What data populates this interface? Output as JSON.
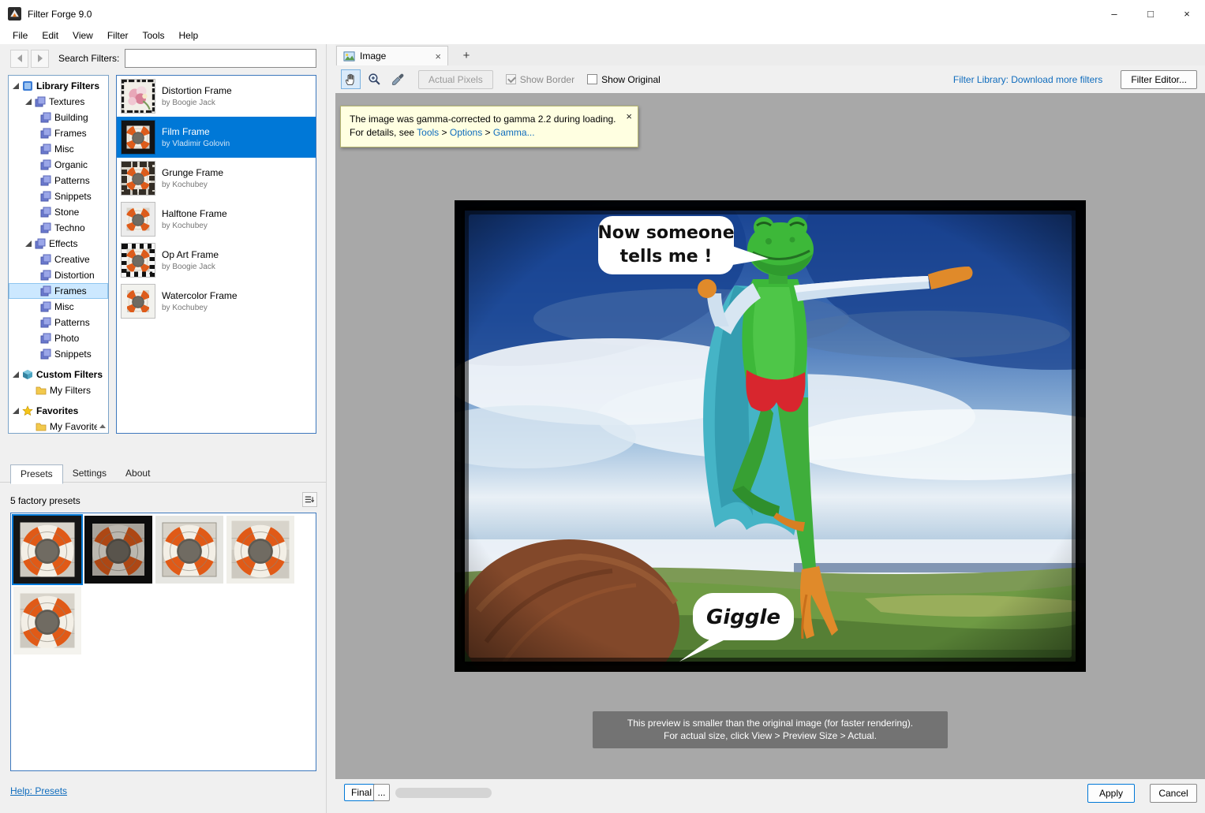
{
  "window": {
    "title": "Filter Forge 9.0",
    "minimize": "–",
    "maximize": "□",
    "close": "×"
  },
  "menu": {
    "items": [
      "File",
      "Edit",
      "View",
      "Filter",
      "Tools",
      "Help"
    ]
  },
  "browser": {
    "search_label": "Search Filters:",
    "tree": [
      {
        "label": "Library Filters"
      },
      {
        "label": "Textures"
      },
      {
        "label": "Building"
      },
      {
        "label": "Frames"
      },
      {
        "label": "Misc"
      },
      {
        "label": "Organic"
      },
      {
        "label": "Patterns"
      },
      {
        "label": "Snippets"
      },
      {
        "label": "Stone"
      },
      {
        "label": "Techno"
      },
      {
        "label": "Effects"
      },
      {
        "label": "Creative"
      },
      {
        "label": "Distortion"
      },
      {
        "label": "Frames"
      },
      {
        "label": "Misc"
      },
      {
        "label": "Patterns"
      },
      {
        "label": "Photo"
      },
      {
        "label": "Snippets"
      },
      {
        "label": "Custom Filters"
      },
      {
        "label": "My Filters"
      },
      {
        "label": "Favorites"
      },
      {
        "label": "My Favorites"
      }
    ],
    "filters": [
      {
        "name": "Distortion Frame",
        "author": "by Boogie Jack"
      },
      {
        "name": "Film Frame",
        "author": "by Vladimir Golovin"
      },
      {
        "name": "Grunge Frame",
        "author": "by Kochubey"
      },
      {
        "name": "Halftone Frame",
        "author": "by Kochubey"
      },
      {
        "name": "Op Art Frame",
        "author": "by Boogie Jack"
      },
      {
        "name": "Watercolor Frame",
        "author": "by Kochubey"
      }
    ]
  },
  "presets": {
    "tabs": [
      "Presets",
      "Settings",
      "About"
    ],
    "count_label": "5 factory presets",
    "help_link": "Help: Presets"
  },
  "workspace": {
    "tab_label": "Image",
    "tab_close": "×",
    "new_tab": "+",
    "toolbar": {
      "actual_pixels": "Actual Pixels",
      "show_border": "Show Border",
      "show_original": "Show Original",
      "library_link": "Filter Library: Download more filters",
      "filter_editor": "Filter Editor..."
    },
    "gamma_note": {
      "line1": "The image was gamma-corrected to gamma 2.2 during loading.",
      "line2_prefix": "For details, see ",
      "link_tools": "Tools",
      "link_options": "Options",
      "link_gamma": "Gamma...",
      "sep": " > ",
      "close": "×"
    },
    "image": {
      "bubble1_line1": "Now someone",
      "bubble1_line2": "tells me !",
      "bubble2": "Giggle"
    },
    "preview_note": {
      "line1": "This preview is smaller than the original image (for faster rendering).",
      "line2": "For actual size, click View > Preview Size > Actual."
    },
    "bottom": {
      "final": "Final",
      "more": "...",
      "apply": "Apply",
      "cancel": "Cancel"
    }
  },
  "colors": {
    "accent": "#0078d7",
    "link": "#0f6cbd",
    "canvas": "#a8a8a8",
    "note_bg": "#ffffe1"
  }
}
